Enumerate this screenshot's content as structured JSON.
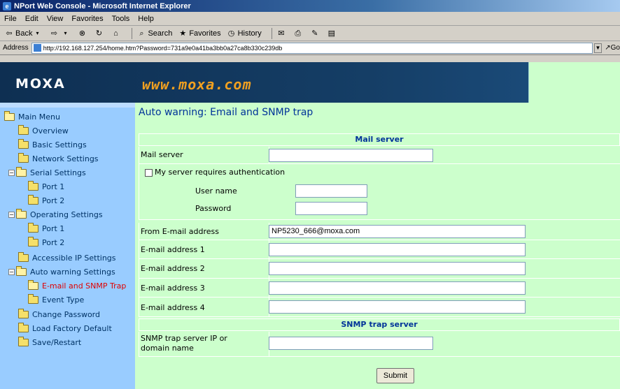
{
  "browser": {
    "window_title": "NPort Web Console - Microsoft Internet Explorer",
    "menu": [
      "File",
      "Edit",
      "View",
      "Favorites",
      "Tools",
      "Help"
    ],
    "toolbar": {
      "back": "Back",
      "search": "Search",
      "favorites": "Favorites",
      "history": "History"
    },
    "address_label": "Address",
    "url": "http://192.168.127.254/home.htm?Password=731a9e0a41ba3bb0a27ca8b330c239db",
    "go_label": "Go"
  },
  "header": {
    "logo": "MOXA",
    "site": "www.moxa.com"
  },
  "sidebar": {
    "items": [
      {
        "label": "Main Menu"
      },
      {
        "label": "Overview"
      },
      {
        "label": "Basic Settings"
      },
      {
        "label": "Network Settings"
      },
      {
        "label": "Serial Settings"
      },
      {
        "label": "Port 1"
      },
      {
        "label": "Port 2"
      },
      {
        "label": "Operating Settings"
      },
      {
        "label": "Port 1"
      },
      {
        "label": "Port 2"
      },
      {
        "label": "Accessible IP Settings"
      },
      {
        "label": "Auto warning Settings"
      },
      {
        "label": "E-mail and SNMP Trap"
      },
      {
        "label": "Event Type"
      },
      {
        "label": "Change Password"
      },
      {
        "label": "Load Factory Default"
      },
      {
        "label": "Save/Restart"
      }
    ]
  },
  "main": {
    "title": "Auto warning: Email and SNMP trap",
    "mail_section": "Mail server",
    "mail_server_label": "Mail server",
    "mail_server_value": "",
    "auth_label": "My server requires authentication",
    "username_label": "User name",
    "username_value": "",
    "password_label": "Password",
    "password_value": "",
    "from_label": "From E-mail address",
    "from_value": "NP5230_666@moxa.com",
    "email1_label": "E-mail address 1",
    "email1_value": "",
    "email2_label": "E-mail address 2",
    "email2_value": "",
    "email3_label": "E-mail address 3",
    "email3_value": "",
    "email4_label": "E-mail address 4",
    "email4_value": "",
    "snmp_section": "SNMP trap server",
    "snmp_label_line1": "SNMP trap server IP or",
    "snmp_label_line2": "domain name",
    "snmp_value": "",
    "submit_label": "Submit"
  },
  "colors": {
    "content_bg": "#ccffcc",
    "sidebar_bg": "#99ccff",
    "banner_bg": "#0f3358",
    "active_item": "#e00000",
    "section_text": "#003399"
  }
}
